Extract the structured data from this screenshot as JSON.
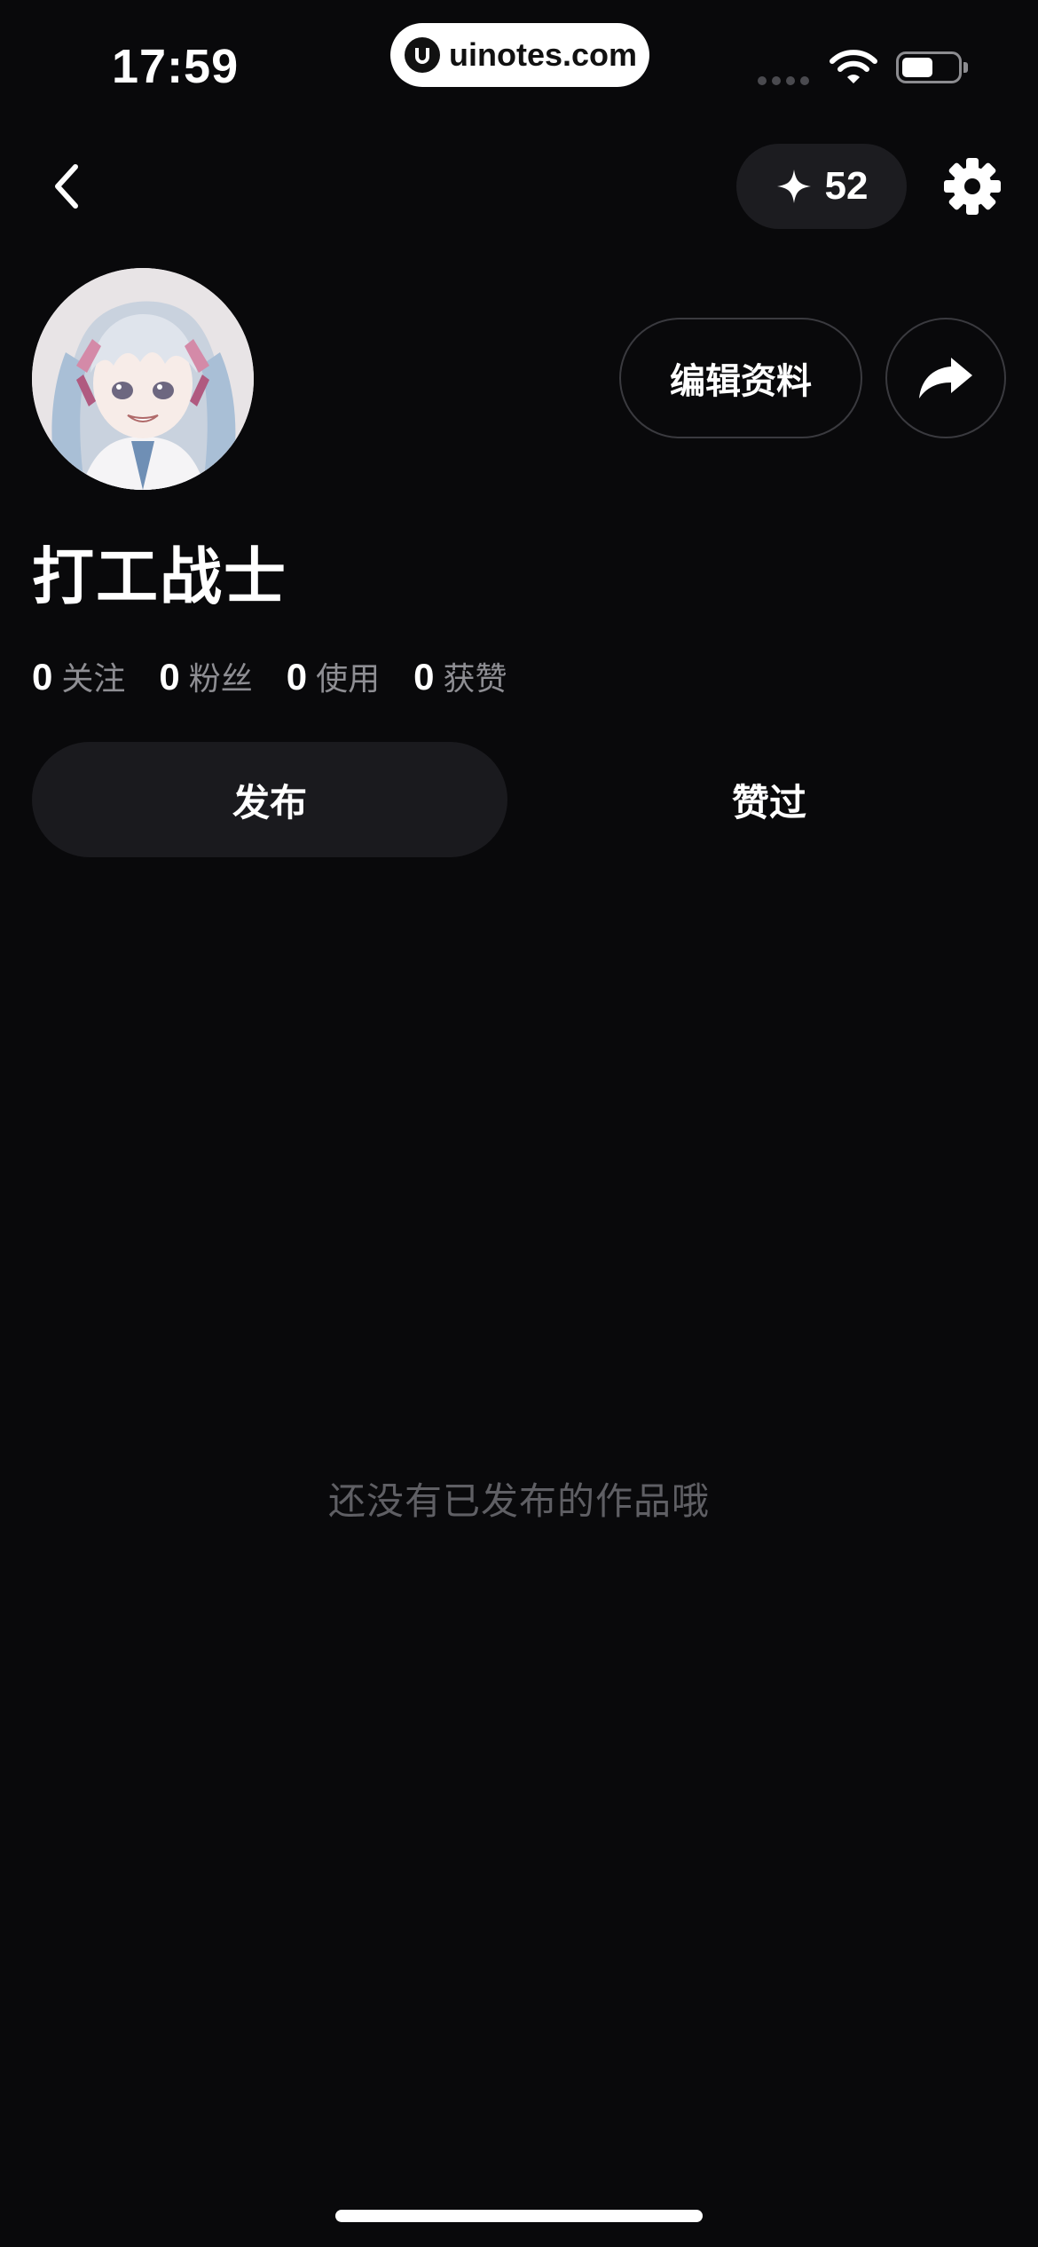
{
  "status_bar": {
    "time": "17:59",
    "watermark": "uinotes.com"
  },
  "nav": {
    "back_icon": "chevron-left-icon",
    "credits": "52",
    "credits_icon": "sparkle-icon",
    "settings_icon": "gear-icon"
  },
  "profile": {
    "username": "打工战士",
    "edit_label": "编辑资料",
    "share_icon": "share-arrow-icon",
    "stats": [
      {
        "value": "0",
        "label": "关注"
      },
      {
        "value": "0",
        "label": "粉丝"
      },
      {
        "value": "0",
        "label": "使用"
      },
      {
        "value": "0",
        "label": "获赞"
      }
    ]
  },
  "tabs": [
    {
      "label": "发布",
      "active": true
    },
    {
      "label": "赞过",
      "active": false
    }
  ],
  "empty_state": {
    "text": "还没有已发布的作品哦"
  },
  "colors": {
    "background": "#09090b",
    "pill": "#1c1c20",
    "muted_text": "#8e8e93",
    "empty_text": "#5f5f64"
  }
}
